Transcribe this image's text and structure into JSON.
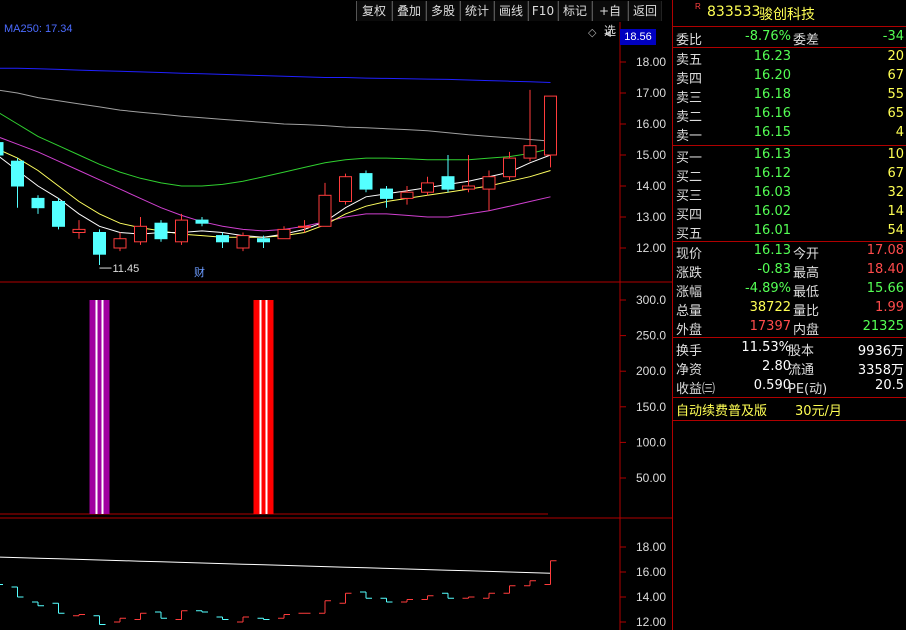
{
  "toolbar": {
    "buttons": [
      "复权",
      "叠加",
      "多股",
      "统计",
      "画线",
      "F10",
      "标记",
      "+自选",
      "返回"
    ]
  },
  "chart": {
    "ma_label": "MA250: 17.34",
    "current_price_tag": "18.56",
    "low_annotation": "11.45",
    "event_marker": "财",
    "main_ticks": [
      "18.00",
      "17.00",
      "16.00",
      "15.00",
      "14.00",
      "13.00",
      "12.00"
    ],
    "volume_ticks": [
      "300.0",
      "250.0",
      "200.0",
      "150.0",
      "100.0",
      "50.00"
    ],
    "bottom_ticks": [
      "18.00",
      "16.00",
      "14.00",
      "12.00"
    ]
  },
  "chart_data": {
    "type": "candlestick",
    "candles": [
      {
        "o": 15.4,
        "c": 15.0,
        "h": 15.6,
        "l": 14.8
      },
      {
        "o": 14.8,
        "c": 14.0,
        "h": 14.9,
        "l": 13.3
      },
      {
        "o": 13.6,
        "c": 13.3,
        "h": 13.7,
        "l": 13.1
      },
      {
        "o": 13.5,
        "c": 12.7,
        "h": 13.6,
        "l": 12.6
      },
      {
        "o": 12.5,
        "c": 12.6,
        "h": 12.9,
        "l": 12.3
      },
      {
        "o": 12.5,
        "c": 11.8,
        "h": 12.6,
        "l": 11.45
      },
      {
        "o": 12.0,
        "c": 12.3,
        "h": 12.5,
        "l": 11.9
      },
      {
        "o": 12.2,
        "c": 12.7,
        "h": 13.0,
        "l": 12.1
      },
      {
        "o": 12.8,
        "c": 12.3,
        "h": 12.9,
        "l": 12.2
      },
      {
        "o": 12.2,
        "c": 12.9,
        "h": 13.1,
        "l": 12.1
      },
      {
        "o": 12.9,
        "c": 12.8,
        "h": 13.0,
        "l": 12.7
      },
      {
        "o": 12.4,
        "c": 12.2,
        "h": 12.5,
        "l": 12.0
      },
      {
        "o": 12.0,
        "c": 12.4,
        "h": 12.5,
        "l": 11.9
      },
      {
        "o": 12.3,
        "c": 12.2,
        "h": 12.4,
        "l": 12.0
      },
      {
        "o": 12.3,
        "c": 12.6,
        "h": 12.7,
        "l": 12.3
      },
      {
        "o": 12.7,
        "c": 12.7,
        "h": 12.9,
        "l": 12.5
      },
      {
        "o": 12.7,
        "c": 13.7,
        "h": 14.1,
        "l": 12.7
      },
      {
        "o": 13.5,
        "c": 14.3,
        "h": 14.4,
        "l": 13.4
      },
      {
        "o": 14.4,
        "c": 13.9,
        "h": 14.5,
        "l": 13.8
      },
      {
        "o": 13.9,
        "c": 13.6,
        "h": 14.0,
        "l": 13.3
      },
      {
        "o": 13.6,
        "c": 13.8,
        "h": 14.0,
        "l": 13.4
      },
      {
        "o": 13.8,
        "c": 14.1,
        "h": 14.3,
        "l": 13.7
      },
      {
        "o": 14.3,
        "c": 13.9,
        "h": 15.0,
        "l": 13.8
      },
      {
        "o": 13.9,
        "c": 14.0,
        "h": 15.0,
        "l": 13.8
      },
      {
        "o": 13.9,
        "c": 14.3,
        "h": 14.5,
        "l": 13.2
      },
      {
        "o": 14.3,
        "c": 14.9,
        "h": 15.1,
        "l": 14.2
      },
      {
        "o": 14.9,
        "c": 15.3,
        "h": 17.1,
        "l": 14.8
      },
      {
        "o": 15.0,
        "c": 16.9,
        "h": 16.9,
        "l": 14.6
      }
    ],
    "ma_lines": [
      {
        "color": "#2020ff",
        "points": [
          17.8,
          17.8,
          17.78,
          17.76,
          17.74,
          17.72,
          17.7,
          17.68,
          17.66,
          17.64,
          17.62,
          17.6,
          17.58,
          17.56,
          17.54,
          17.52,
          17.5,
          17.5,
          17.48,
          17.47,
          17.46,
          17.45,
          17.44,
          17.42,
          17.4,
          17.38,
          17.36,
          17.34
        ]
      },
      {
        "color": "#a0a0a0",
        "points": [
          17.1,
          17.0,
          16.85,
          16.75,
          16.65,
          16.55,
          16.45,
          16.38,
          16.32,
          16.25,
          16.2,
          16.15,
          16.1,
          16.05,
          16.0,
          15.98,
          15.95,
          15.9,
          15.88,
          15.85,
          15.82,
          15.78,
          15.72,
          15.65,
          15.6,
          15.55,
          15.5,
          15.45
        ]
      },
      {
        "color": "#30d030",
        "points": [
          16.4,
          16.0,
          15.6,
          15.3,
          15.0,
          14.7,
          14.45,
          14.25,
          14.1,
          14.0,
          14.0,
          14.05,
          14.15,
          14.3,
          14.45,
          14.6,
          14.75,
          14.85,
          14.9,
          14.9,
          14.88,
          14.85,
          14.85,
          14.85,
          14.9,
          14.95,
          15.05,
          15.2
        ]
      },
      {
        "color": "#d040d0",
        "points": [
          15.6,
          15.35,
          15.1,
          14.8,
          14.5,
          14.2,
          13.9,
          13.6,
          13.3,
          13.05,
          12.85,
          12.7,
          12.6,
          12.55,
          12.6,
          12.7,
          12.85,
          13.0,
          13.1,
          13.1,
          13.05,
          13.0,
          13.0,
          13.1,
          13.2,
          13.35,
          13.5,
          13.65
        ]
      },
      {
        "color": "#ffff60",
        "points": [
          15.2,
          14.9,
          14.5,
          14.0,
          13.5,
          13.1,
          12.8,
          12.65,
          12.55,
          12.45,
          12.4,
          12.35,
          12.35,
          12.35,
          12.4,
          12.5,
          12.75,
          13.1,
          13.35,
          13.5,
          13.6,
          13.7,
          13.8,
          13.9,
          14.0,
          14.15,
          14.3,
          14.5
        ]
      },
      {
        "color": "#ffffff",
        "points": [
          15.0,
          14.5,
          14.0,
          13.6,
          13.1,
          12.7,
          12.5,
          12.45,
          12.5,
          12.5,
          12.55,
          12.5,
          12.4,
          12.35,
          12.45,
          12.6,
          12.85,
          13.3,
          13.65,
          13.75,
          13.85,
          13.95,
          14.05,
          14.15,
          14.3,
          14.45,
          14.75,
          15.0
        ]
      }
    ],
    "volume_bars": [
      {
        "index": 5,
        "value": 300,
        "color": "#a000a0"
      },
      {
        "index": 13,
        "value": 300,
        "color": "#ff0000"
      }
    ]
  },
  "quote": {
    "code": "833533",
    "name": "骏创科技",
    "flag": "R",
    "weibi_label": "委比",
    "weibi_value": "-8.76%",
    "weicha_label": "委差",
    "weicha_value": "-34",
    "asks": [
      {
        "label": "卖五",
        "price": "16.23",
        "vol": "20"
      },
      {
        "label": "卖四",
        "price": "16.20",
        "vol": "67"
      },
      {
        "label": "卖三",
        "price": "16.18",
        "vol": "55"
      },
      {
        "label": "卖二",
        "price": "16.16",
        "vol": "65"
      },
      {
        "label": "卖一",
        "price": "16.15",
        "vol": "4"
      }
    ],
    "bids": [
      {
        "label": "买一",
        "price": "16.13",
        "vol": "10"
      },
      {
        "label": "买二",
        "price": "16.12",
        "vol": "67"
      },
      {
        "label": "买三",
        "price": "16.03",
        "vol": "32"
      },
      {
        "label": "买四",
        "price": "16.02",
        "vol": "14"
      },
      {
        "label": "买五",
        "price": "16.01",
        "vol": "54"
      }
    ],
    "stats": [
      {
        "l1": "现价",
        "v1": "16.13",
        "c1": "green",
        "l2": "今开",
        "v2": "17.08",
        "c2": "red"
      },
      {
        "l1": "涨跌",
        "v1": "-0.83",
        "c1": "green",
        "l2": "最高",
        "v2": "18.40",
        "c2": "red"
      },
      {
        "l1": "涨幅",
        "v1": "-4.89%",
        "c1": "green",
        "l2": "最低",
        "v2": "15.66",
        "c2": "green"
      },
      {
        "l1": "总量",
        "v1": "38722",
        "c1": "yellow",
        "l2": "量比",
        "v2": "1.99",
        "c2": "red"
      },
      {
        "l1": "外盘",
        "v1": "17397",
        "c1": "red",
        "l2": "内盘",
        "v2": "21325",
        "c2": "green"
      }
    ],
    "fundamentals": [
      {
        "l1": "换手",
        "v1": "11.53%",
        "l2": "股本",
        "v2": "9936万"
      },
      {
        "l1": "净资",
        "v1": "2.80",
        "l2": "流通",
        "v2": "3358万"
      },
      {
        "l1": "收益㈢",
        "v1": "0.590",
        "l2": "PE(动)",
        "v2": "20.5"
      }
    ],
    "promo_text": "自动续费普及版",
    "promo_price": "30元/月"
  }
}
